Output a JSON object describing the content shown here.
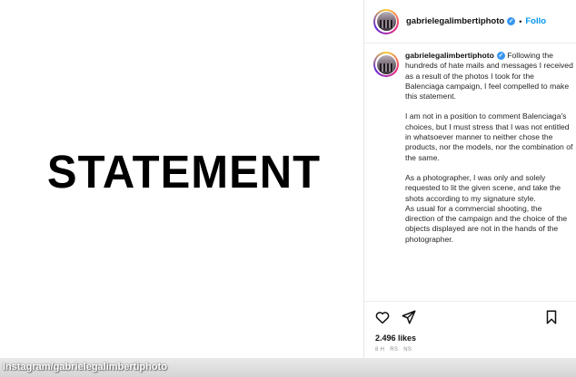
{
  "image": {
    "headline": "STATEMENT"
  },
  "header": {
    "username": "gabrielegalimbertiphoto",
    "follow_label": "Follo"
  },
  "caption": {
    "username": "gabrielegalimbertiphoto",
    "paragraphs": [
      "Following the hundreds of hate mails and messages I received as a result of the photos I took for the Balenciaga campaign, I feel compelled to make this statement.",
      "I am not in a position to comment Balenciaga's choices, but I must stress that I was not entitled in whatsoever manner to neither chose the products, nor the models, nor the combination of the same.",
      "As a photographer, I was only and solely requested to lit the given scene, and take the shots according to my signature style.",
      "As usual for a commercial shooting, the direction of the campaign and the choice of the objects displayed are not in the hands of the photographer."
    ]
  },
  "actions": {
    "likes": "2.496 likes",
    "meta": [
      "8 H",
      "RS",
      "NS"
    ]
  },
  "credit": "Instagram/gabrielegalimbertiphoto",
  "colors": {
    "verified": "#3897f0",
    "follow": "#0095f6"
  }
}
